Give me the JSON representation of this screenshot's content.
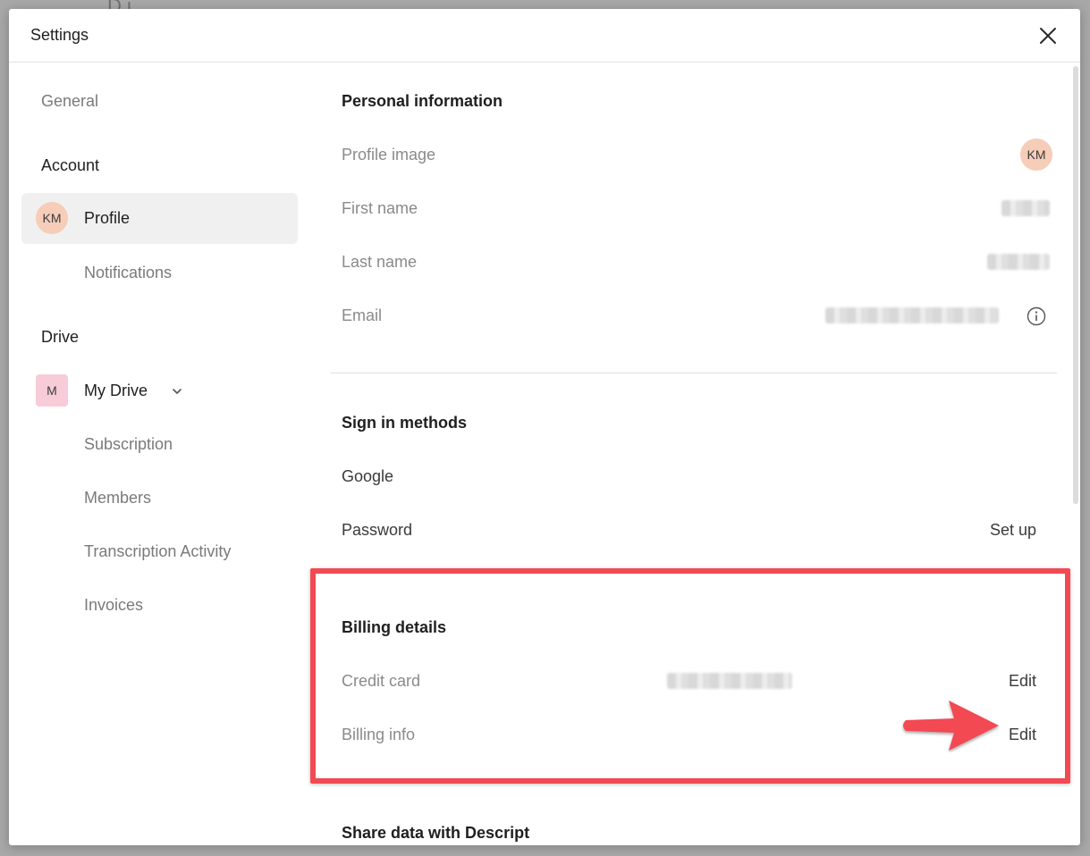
{
  "backdrop": {
    "partial_text": "D i"
  },
  "dialog": {
    "title": "Settings"
  },
  "sidebar": {
    "general": "General",
    "account_heading": "Account",
    "profile": {
      "avatar_initials": "KM",
      "label": "Profile"
    },
    "notifications": "Notifications",
    "drive_heading": "Drive",
    "my_drive": {
      "avatar_initial": "M",
      "label": "My Drive"
    },
    "subscription": "Subscription",
    "members": "Members",
    "transcription_activity": "Transcription Activity",
    "invoices": "Invoices"
  },
  "personal_info": {
    "title": "Personal information",
    "profile_image_label": "Profile image",
    "profile_image_initials": "KM",
    "first_name_label": "First name",
    "last_name_label": "Last name",
    "email_label": "Email"
  },
  "sign_in": {
    "title": "Sign in methods",
    "google": "Google",
    "password": "Password",
    "password_action": "Set up"
  },
  "billing": {
    "title": "Billing details",
    "credit_card_label": "Credit card",
    "credit_card_action": "Edit",
    "billing_info_label": "Billing info",
    "billing_info_action": "Edit"
  },
  "share_data": {
    "title": "Share data with Descript"
  },
  "colors": {
    "highlight": "#f24a52",
    "avatar_profile": "#f6cdb8",
    "avatar_drive": "#f8cbd9",
    "active_nav_bg": "#f0f0f0"
  },
  "icons": [
    "close-icon",
    "chevron-down-icon",
    "info-icon",
    "arrow-annotation-icon"
  ]
}
